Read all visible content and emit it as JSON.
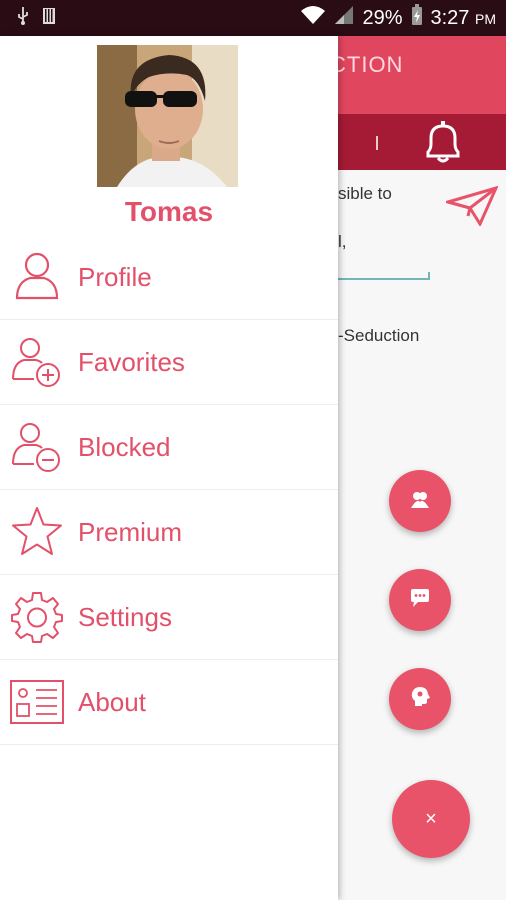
{
  "status_bar": {
    "battery_percent": "29%",
    "time": "3:27",
    "time_period": "PM"
  },
  "background": {
    "app_title_partial": "CTION",
    "snippet_line1": "sible to",
    "snippet_line2": "l,",
    "snippet_line3": "-Seduction"
  },
  "drawer": {
    "username": "Tomas",
    "menu": [
      {
        "label": "Profile",
        "icon": "person-icon"
      },
      {
        "label": "Favorites",
        "icon": "add-person-icon"
      },
      {
        "label": "Blocked",
        "icon": "remove-person-icon"
      },
      {
        "label": "Premium",
        "icon": "star-icon"
      },
      {
        "label": "Settings",
        "icon": "gear-icon"
      },
      {
        "label": "About",
        "icon": "id-card-icon"
      }
    ]
  },
  "fabs": {
    "close_label": "×"
  },
  "colors": {
    "accent": "#e3506a",
    "appbar": "#e0475f",
    "tabbar": "#a51b36",
    "statusbar": "#2a0d14"
  }
}
